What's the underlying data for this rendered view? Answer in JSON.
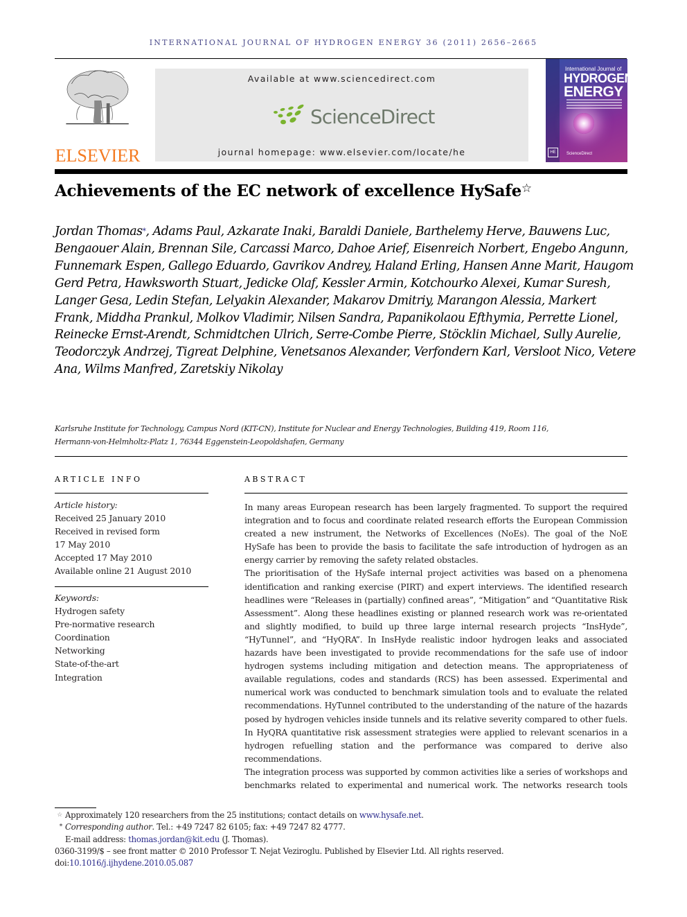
{
  "running_head": "INTERNATIONAL JOURNAL OF HYDROGEN ENERGY 36 (2011) 2656–2665",
  "masthead": {
    "publisher_logo_text": "ELSEVIER",
    "available_at": "Available at www.sciencedirect.com",
    "sciencedirect_logo_text": "ScienceDirect",
    "homepage": "journal homepage: www.elsevier.com/locate/he",
    "cover": {
      "line1": "International Journal of",
      "line2": "HYDROGEN",
      "line3": "ENERGY",
      "footer": "ScienceDirect",
      "badge": "HE"
    },
    "colors": {
      "elsevier_orange": "#f47a20",
      "sciencedirect_green": "#7ab32e",
      "sciencedirect_gray": "#6f7a6c",
      "link_blue": "#2b2b8c",
      "masthead_bg": "#e8e8e8"
    }
  },
  "article": {
    "title": "Achievements of the EC network of excellence HySafe",
    "title_note_mark": "☆",
    "first_author": "Jordan Thomas",
    "corresponding_mark": "*",
    "authors_rest": ", Adams Paul, Azkarate Inaki, Baraldi Daniele, Barthelemy Herve, Bauwens Luc, Bengaouer Alain, Brennan Sile, Carcassi Marco, Dahoe Arief, Eisenreich Norbert, Engebo Angunn, Funnemark Espen, Gallego Eduardo, Gavrikov Andrey, Haland Erling, Hansen Anne Marit, Haugom Gerd Petra, Hawksworth Stuart, Jedicke Olaf, Kessler Armin, Kotchourko Alexei, Kumar Suresh, Langer Gesa, Ledin Stefan, Lelyakin Alexander, Makarov Dmitriy, Marangon Alessia, Markert Frank, Middha Prankul, Molkov Vladimir, Nilsen Sandra, Papanikolaou Efthymia, Perrette Lionel, Reinecke Ernst-Arendt, Schmidtchen Ulrich, Serre-Combe Pierre, Stöcklin Michael, Sully Aurelie, Teodorczyk Andrzej, Tigreat Delphine, Venetsanos Alexander, Verfondern Karl, Versloot Nico, Vetere Ana, Wilms Manfred, Zaretskiy Nikolay",
    "affiliation_line1": "Karlsruhe Institute for Technology, Campus Nord (KIT-CN), Institute for Nuclear and Energy Technologies, Building 419, Room 116,",
    "affiliation_line2": "Hermann-von-Helmholtz-Platz 1, 76344 Eggenstein-Leopoldshafen, Germany"
  },
  "article_info": {
    "heading": "ARTICLE INFO",
    "history_label": "Article history:",
    "history": [
      "Received 25 January 2010",
      "Received in revised form",
      "17 May 2010",
      "Accepted 17 May 2010",
      "Available online 21 August 2010"
    ],
    "keywords_label": "Keywords:",
    "keywords": [
      "Hydrogen safety",
      "Pre-normative research",
      "Coordination",
      "Networking",
      "State-of-the-art",
      "Integration"
    ]
  },
  "abstract": {
    "heading": "ABSTRACT",
    "paragraphs": [
      "In many areas European research has been largely fragmented. To support the required integration and to focus and coordinate related research efforts the European Commission created a new instrument, the Networks of Excellences (NoEs). The goal of the NoE HySafe has been to provide the basis to facilitate the safe introduction of hydrogen as an energy carrier by removing the safety related obstacles.",
      "The prioritisation of the HySafe internal project activities was based on a phenomena identification and ranking exercise (PIRT) and expert interviews. The identified research headlines were “Releases in (partially) confined areas”, “Mitigation” and “Quantitative Risk Assessment”. Along these headlines existing or planned research work was re-orientated and slightly modified, to build up three large internal research projects “InsHyde”, “HyTunnel”, and “HyQRA”. In InsHyde realistic indoor hydrogen leaks and associated hazards have been investigated to provide recommendations for the safe use of indoor hydrogen systems including mitigation and detection means. The appropriateness of available regulations, codes and standards (RCS) has been assessed. Experimental and numerical work was conducted to benchmark simulation tools and to evaluate the related recommendations. HyTunnel contributed to the understanding of the nature of the hazards posed by hydrogen vehicles inside tunnels and its relative severity compared to other fuels. In HyQRA quantitative risk assessment strategies were applied to relevant scenarios in a hydrogen refuelling station and the performance was compared to derive also recommendations.",
      "The integration process was supported by common activities like a series of workshops and benchmarks related to experimental and numerical work. The networks research tools"
    ]
  },
  "footnotes": {
    "star_mark": "☆",
    "star_text": "Approximately 120 researchers from the 25 institutions; contact details on ",
    "star_link": "www.hysafe.net",
    "star_end": ".",
    "corr_mark": "*",
    "corr_label": "Corresponding author",
    "corr_text": ". Tel.: +49 7247 82 6105; fax: +49 7247 82 4777.",
    "email_label": "E-mail address: ",
    "email": "thomas.jordan@kit.edu",
    "email_after": " (J. Thomas).",
    "copyright": "0360-3199/$ – see front matter © 2010 Professor T. Nejat Veziroglu. Published by Elsevier Ltd. All rights reserved.",
    "doi_label": "doi:",
    "doi": "10.1016/j.ijhydene.2010.05.087"
  }
}
